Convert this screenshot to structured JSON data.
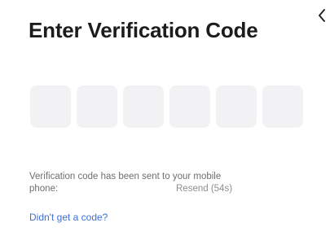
{
  "header": {
    "title": "Enter Verification Code",
    "back_icon": "chevron-left-icon"
  },
  "code_input": {
    "length": 6,
    "digits": [
      "",
      "",
      "",
      "",
      "",
      ""
    ]
  },
  "message": {
    "line1": "Verification code has been sent to your mobile",
    "phone_label": "phone:",
    "resend_label": "Resend (54s)"
  },
  "help": {
    "link_label": "Didn't get a code?"
  },
  "colors": {
    "title": "#1c1c1e",
    "box_background": "#f2f2f4",
    "secondary_text": "#6e6e73",
    "link": "#3b6fd9"
  }
}
